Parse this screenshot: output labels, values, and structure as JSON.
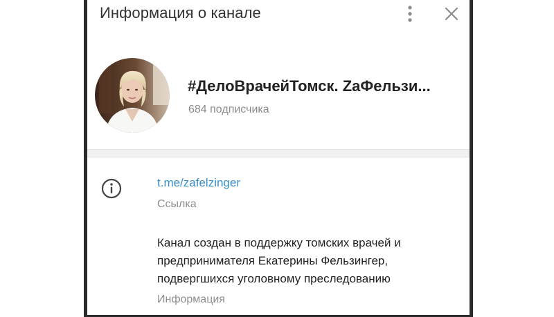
{
  "header": {
    "title": "Информация о канале",
    "menu_icon": "more-vertical-icon",
    "close_icon": "close-icon"
  },
  "channel": {
    "name": "#ДелоВрачейТомск. ZaФельзи...",
    "subscribers": "684 подписчика",
    "avatar": "avatar-photo"
  },
  "info": {
    "icon": "info-icon",
    "link": "t.me/zafelzinger",
    "link_caption": "Ссылка",
    "description": "Канал создан в поддержку томских врачей и предпринимателя Екатерины Фельзингер, подвергшихся уголовному преследованию",
    "description_caption": "Информация"
  },
  "colors": {
    "link": "#3a8fc7",
    "secondary_text": "#8e8e8e",
    "primary_text": "#222222",
    "frame": "#2b2b2b",
    "divider": "#f1f1f1"
  }
}
